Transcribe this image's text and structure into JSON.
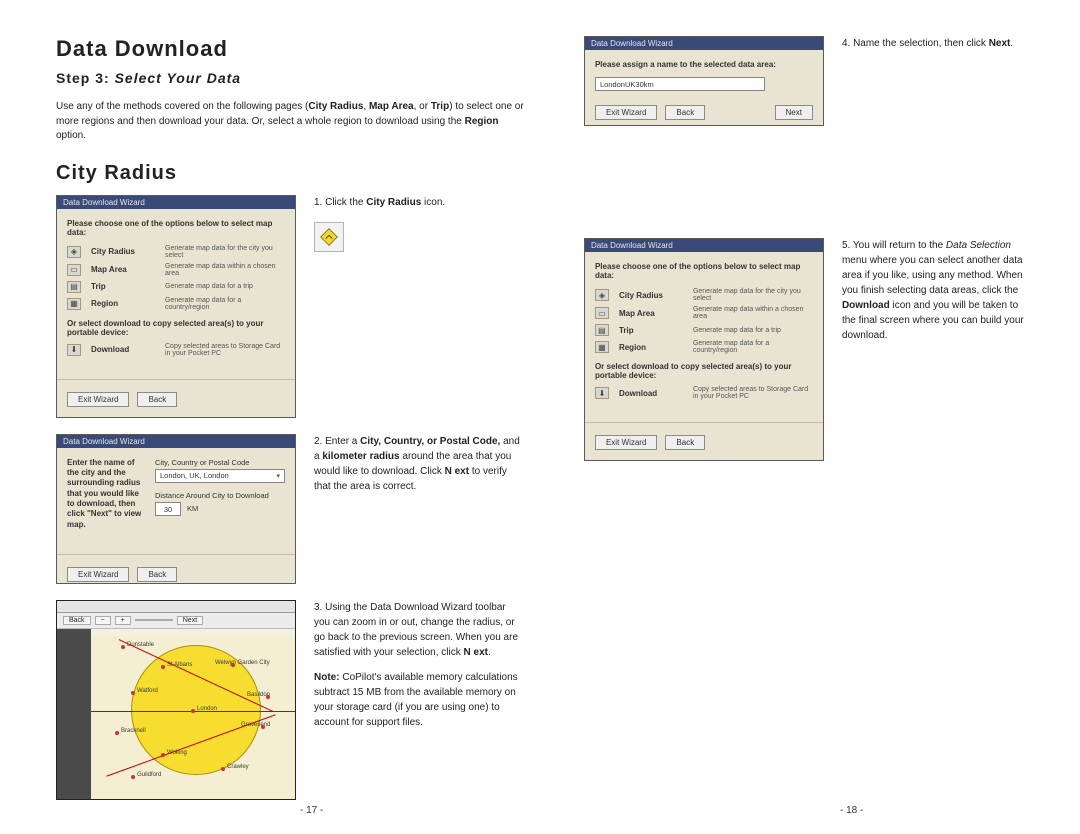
{
  "title": "Data Download",
  "step_label": "Step 3:",
  "step_title": "Select Your Data ",
  "intro_pre": "Use any of the methods covered on the following pages (",
  "intro_b1": "City Radius",
  "intro_sep1": ", ",
  "intro_b2": "Map Area",
  "intro_sep2": ", or ",
  "intro_b3": "Trip",
  "intro_post": ") to select one or more regions and then download your data. Or, select a whole region to download using the ",
  "intro_b4": "Region",
  "intro_end": " option.",
  "section": "City Radius",
  "wizard_title": "Data Download Wizard",
  "wizard_instr": "Please choose one of the options below to select map data:",
  "options": [
    {
      "label": "City Radius",
      "desc": "Generate map data for the city you select"
    },
    {
      "label": "Map Area",
      "desc": "Generate map data within a chosen area"
    },
    {
      "label": "Trip",
      "desc": "Generate map data for a trip"
    },
    {
      "label": "Region",
      "desc": "Generate map data for a country/region"
    }
  ],
  "orselect": "Or select download to copy selected area(s) to your portable device:",
  "download_label": "Download",
  "download_desc": "Copy selected areas to Storage Card in your Pocket PC",
  "btn_exit": "Exit Wizard",
  "btn_back": "Back",
  "btn_next": "Next",
  "step1_pre": "1. Click the ",
  "step1_b": "City Radius",
  "step1_post": " icon.",
  "form_leftlabel": "Enter the name of the city and the surrounding radius that you would like to download, then click \"Next\" to view map.",
  "form_ccp": "City, Country or Postal Code",
  "form_cityval": "London, UK, London",
  "form_dist_label": "Distance Around City to Download",
  "form_km_val": "30",
  "form_km_unit": "KM",
  "step2_pre": "2. Enter a ",
  "step2_b1": "City, Country, or Postal Code,",
  "step2_mid": " and a ",
  "step2_b2": "kilometer radius",
  "step2_post": " around the area that you would like to download. Click ",
  "step2_b3": "N ext",
  "step2_end": " to verify that the area is correct.",
  "maptool_back": "Back",
  "maptool_next": "Next",
  "step3_text_a": "3. Using the Data Download Wizard toolbar you can zoom in or out, change the radius, or go back to the previous screen. When you are satisfied with your selection, click ",
  "step3_b": "N ext",
  "step3_dot": ".",
  "note_label": "Note:",
  "note_text": " CoPilot's available memory calculations subtract 15 MB from the available memory on your storage card (if you are using one) to account for support files.",
  "name_instr": "Please assign a name to the selected data area:",
  "name_value": "LondonUK30km",
  "step4_pre": "4. Name the selection, then click ",
  "step4_b": "Next",
  "step4_dot": ".",
  "step5_pre": "5. You will return to the ",
  "step5_i": "Data Selection",
  "step5_mid": " menu where you can select another data area if you like, using any method. When you finish selecting data areas, click the ",
  "step5_b": "Download",
  "step5_end": " icon and you will be taken to the final screen where you can build your download.",
  "page_left": "- 17 -",
  "page_right": "- 18 -"
}
